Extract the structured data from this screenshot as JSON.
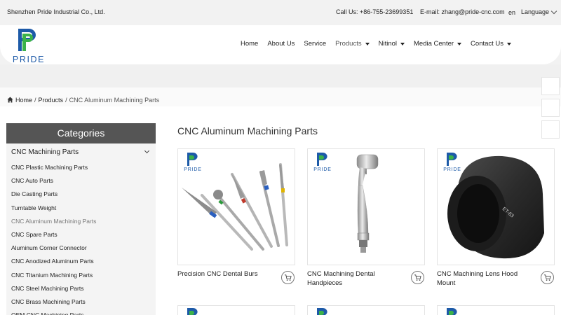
{
  "topbar": {
    "company": "Shenzhen Pride Industrial Co., Ltd.",
    "phone": "Call Us: +86-755-23699351",
    "email": "E-mail: zhang@pride-cnc.com",
    "lang_code": "en",
    "language_label": "Language"
  },
  "brand": {
    "logo_text": "PRIDE",
    "colors": {
      "blue": "#1d5aa8",
      "green": "#3bb24a",
      "dark": "#555555"
    }
  },
  "nav": {
    "home": "Home",
    "about": "About Us",
    "service": "Service",
    "products": "Products",
    "nitinol": "Nitinol",
    "media": "Media Center",
    "contact": "Contact Us"
  },
  "breadcrumb": {
    "home": "Home",
    "products": "Products",
    "current": "CNC Aluminum Machining Parts"
  },
  "sidebar": {
    "header": "Categories",
    "top_category": "CNC Machining Parts",
    "items": [
      "CNC Plastic Machining Parts",
      "CNC Auto Parts",
      "Die Casting Parts",
      "Turntable Weight",
      "CNC Aluminum Machining Parts",
      "CNC Spare Parts",
      "Aluminum Corner Connector",
      "CNC Anodized Aluminum Parts",
      "CNC Titanium Machining Parts",
      "CNC Steel Machining Parts",
      "CNC Brass Machining Parts",
      "OEM CNC Machining Parts"
    ]
  },
  "page_title": "CNC Aluminum Machining Parts",
  "products": [
    {
      "name": "Precision CNC Dental Burs",
      "icon": "cart-icon"
    },
    {
      "name": "CNC Machining Dental Handpieces",
      "icon": "cart-icon"
    },
    {
      "name": "CNC Machining Lens Hood Mount",
      "icon": "cart-icon"
    }
  ],
  "lens_hood_marking": "ET-63"
}
